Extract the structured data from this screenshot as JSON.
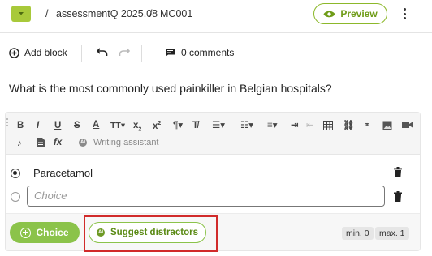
{
  "breadcrumb": {
    "separator": "/",
    "folder": "assessmentQ 2025.08",
    "item": "MC001"
  },
  "header": {
    "preview_label": "Preview"
  },
  "toolbar": {
    "add_block_label": "Add block",
    "comments_label": "0 comments"
  },
  "question": {
    "text": "What is the most commonly used painkiller in Belgian hospitals?"
  },
  "rte": {
    "writing_assistant_label": "Writing assistant",
    "icons": [
      "bold",
      "italic",
      "underline",
      "strikethrough",
      "text-color",
      "font-size",
      "subscript",
      "superscript",
      "paragraph-format",
      "clear-format",
      "bullet-list",
      "numbered-list",
      "align",
      "indent",
      "outdent",
      "table",
      "link",
      "insert-link",
      "image",
      "video",
      "audio",
      "file",
      "formula",
      "writing-assistant"
    ]
  },
  "choices": {
    "items": [
      {
        "text": "Paracetamol",
        "selected": true
      }
    ],
    "new_placeholder": "Choice"
  },
  "footer": {
    "choice_button_label": "Choice",
    "suggest_button_label": "Suggest distractors",
    "min_label": "min. 0",
    "max_label": "max. 1"
  },
  "colors": {
    "accent_green": "#8bc34a",
    "highlight_red": "#d12b2b"
  }
}
